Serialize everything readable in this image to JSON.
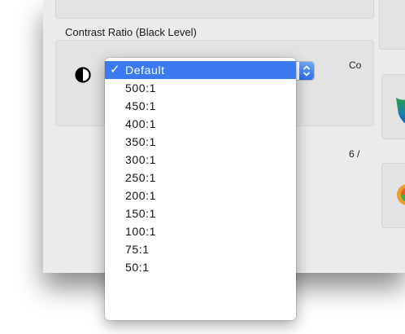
{
  "section": {
    "title": "Contrast Ratio (Black Level)"
  },
  "popup": {
    "selected": "Default",
    "check_mark": "✓",
    "options": [
      "Default",
      "500:1",
      "450:1",
      "400:1",
      "350:1",
      "300:1",
      "250:1",
      "200:1",
      "150:1",
      "100:1",
      "75:1",
      "50:1"
    ]
  },
  "right_panel": {
    "label_1": "Co",
    "label_2": "6 /"
  },
  "icons": {
    "contrast": "contrast-icon",
    "stepper": "popup-stepper-icon"
  },
  "colors": {
    "accent": "#3b79f0",
    "window_bg": "#ebebeb"
  }
}
